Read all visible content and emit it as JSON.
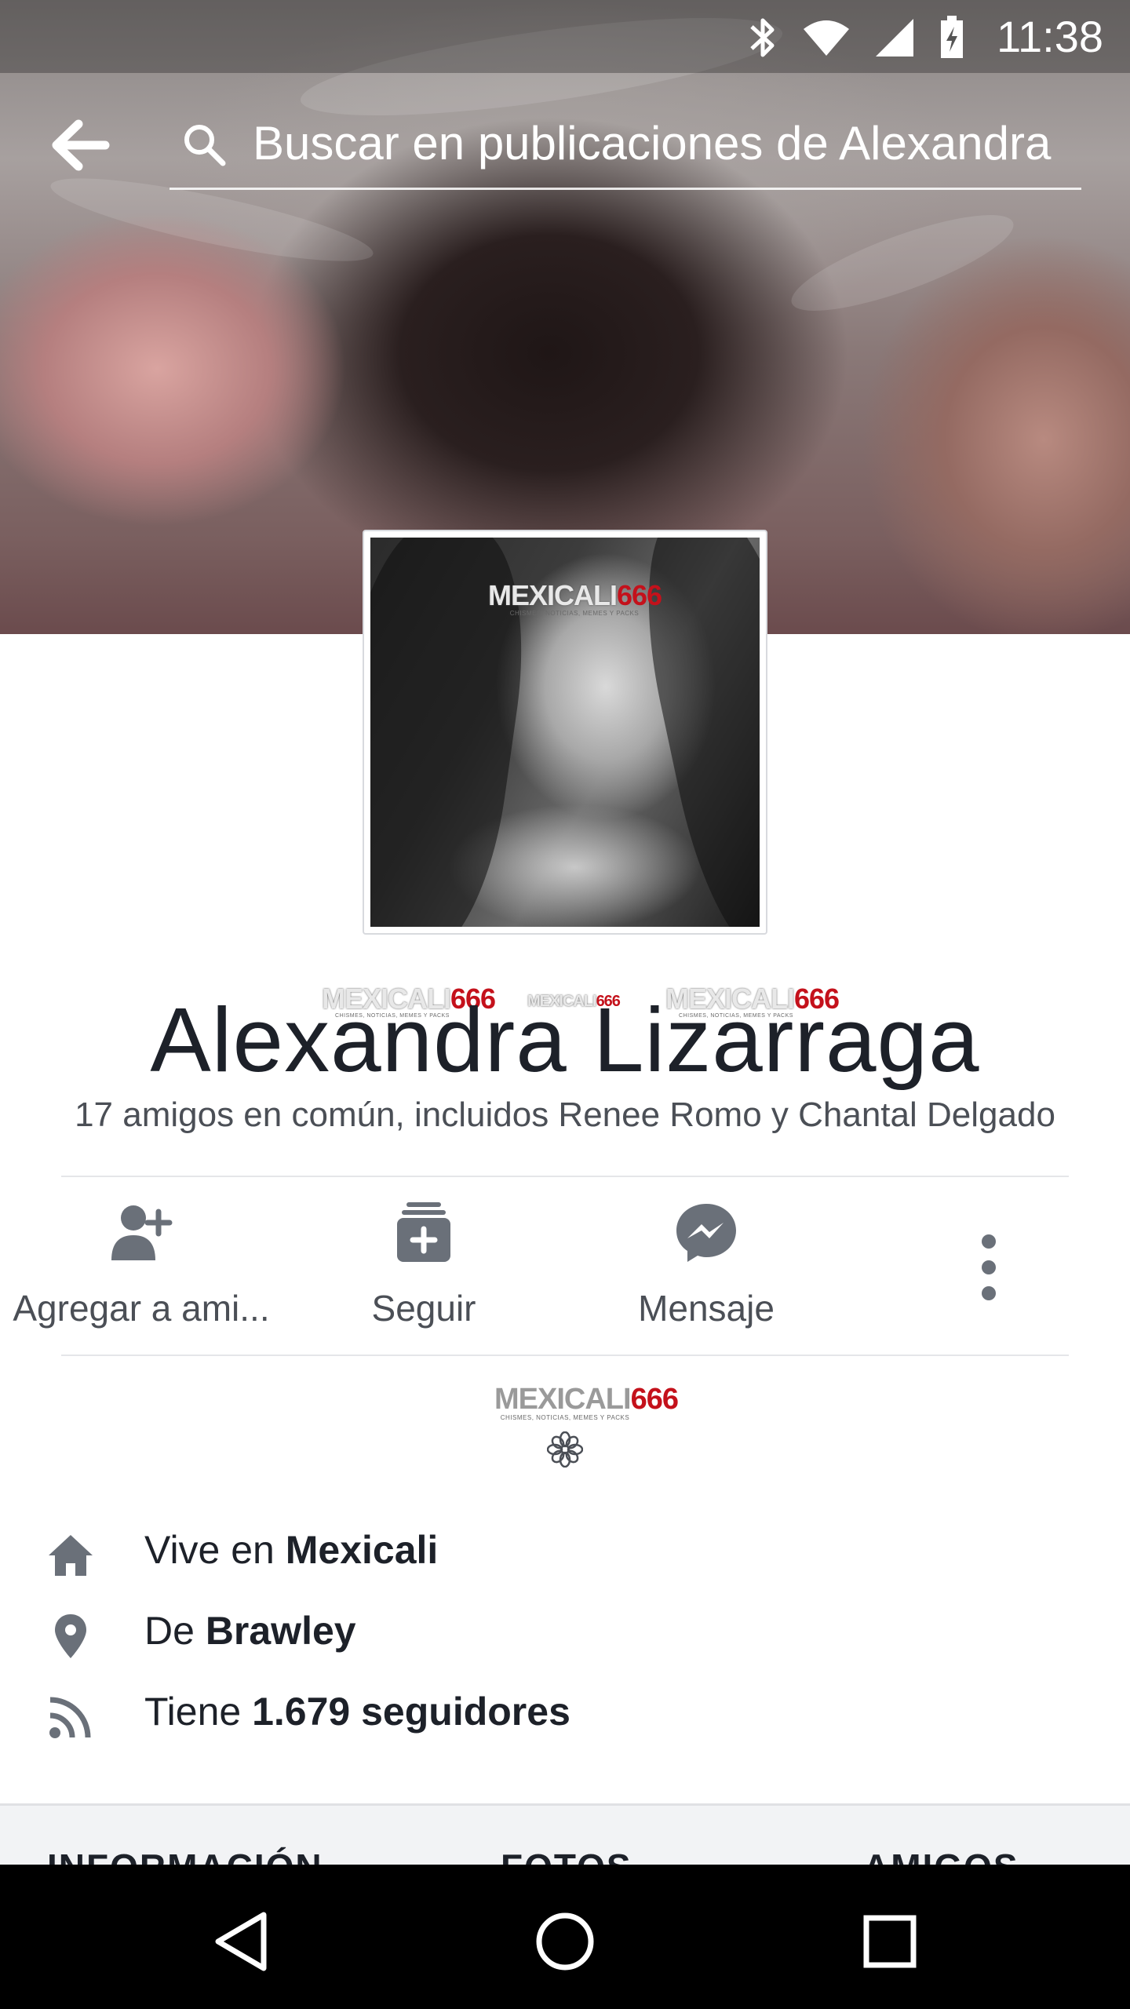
{
  "status_bar": {
    "time": "11:38",
    "icons": [
      "bluetooth-icon",
      "wifi-icon",
      "signal-icon",
      "battery-charging-icon"
    ]
  },
  "search": {
    "placeholder": "Buscar en publicaciones de Alexandra"
  },
  "watermark": {
    "brand_part1": "MEXICALI",
    "brand_part2": "666",
    "tagline": "CHISMES, NOTICIAS, MEMES Y PACKS"
  },
  "profile": {
    "name": "Alexandra Lizarraga",
    "mutual_friends": "17 amigos en común, incluidos Renee Romo y Chantal Delgado"
  },
  "actions": [
    {
      "label": "Agregar a ami...",
      "icon": "add-friend-icon"
    },
    {
      "label": "Seguir",
      "icon": "follow-icon"
    },
    {
      "label": "Mensaje",
      "icon": "messenger-icon"
    }
  ],
  "bio_icon": "flower-icon",
  "info": [
    {
      "icon": "home-icon",
      "prefix": "Vive en ",
      "value": "Mexicali"
    },
    {
      "icon": "location-pin-icon",
      "prefix": "De ",
      "value": "Brawley"
    },
    {
      "icon": "rss-followers-icon",
      "prefix": "Tiene ",
      "value": "1.679 seguidores"
    }
  ],
  "tabs": [
    "INFORMACIÓN",
    "FOTOS",
    "AMIGOS"
  ],
  "colors": {
    "text_primary": "#1d2129",
    "text_secondary": "#4b4f56",
    "icon_grey": "#6a7079",
    "divider": "#e5e6e9",
    "watermark_red": "#c4111b"
  }
}
